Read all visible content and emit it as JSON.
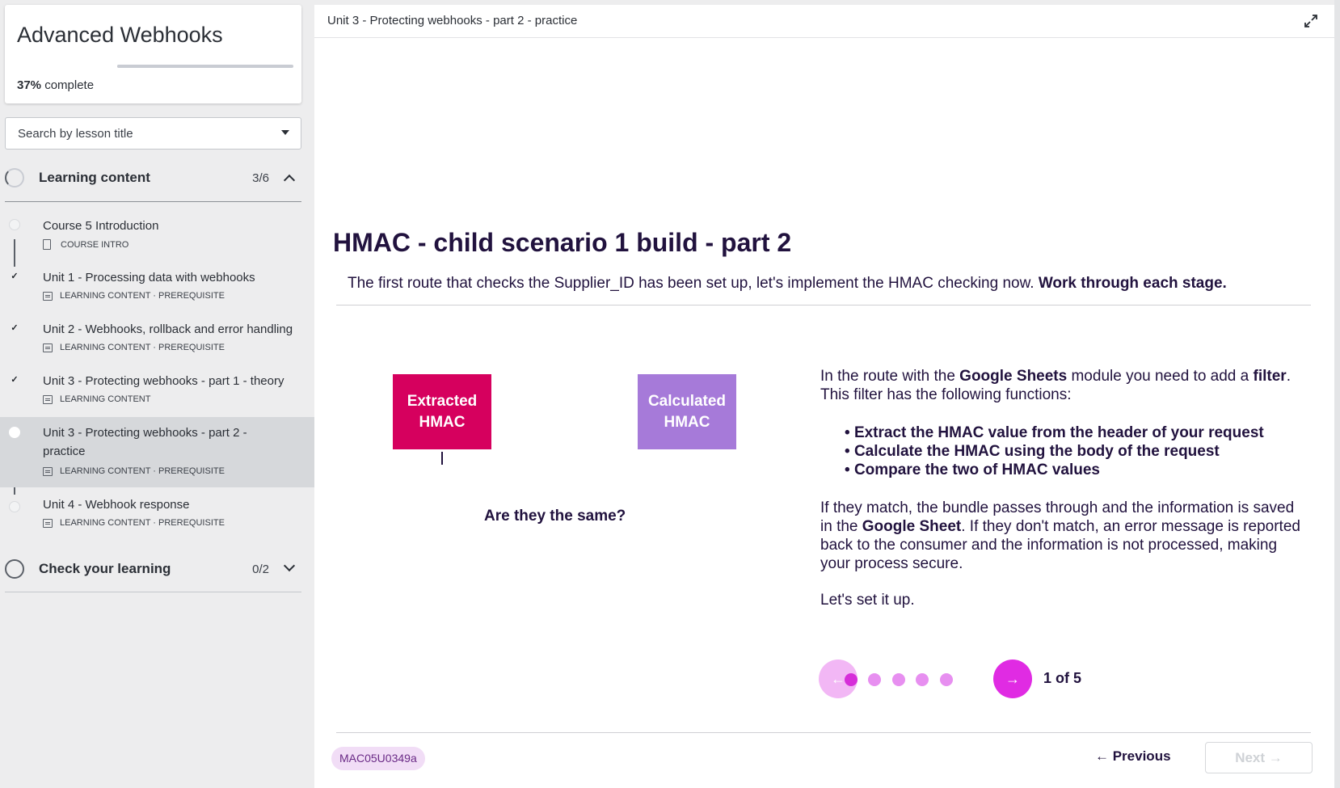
{
  "course": {
    "title": "Advanced Webhooks",
    "progress_percent": 37,
    "progress_value": "37%",
    "progress_suffix": "complete"
  },
  "search": {
    "placeholder": "Search by lesson title"
  },
  "sections": [
    {
      "label": "Learning content",
      "count": "3/6",
      "expanded": true,
      "lessons": [
        {
          "title": "Course 5 Introduction",
          "meta": "COURSE INTRO",
          "done": false,
          "active": false
        },
        {
          "title": "Unit 1 - Processing data with webhooks",
          "meta": "LEARNING CONTENT · PREREQUISITE",
          "done": true,
          "active": false
        },
        {
          "title": "Unit 2 - Webhooks, rollback and error handling",
          "meta": "LEARNING CONTENT · PREREQUISITE",
          "done": true,
          "active": false
        },
        {
          "title": "Unit 3 - Protecting webhooks - part 1 - theory",
          "meta": "LEARNING CONTENT",
          "done": true,
          "active": false
        },
        {
          "title": "Unit 3 - Protecting webhooks - part 2 - practice",
          "meta": "LEARNING CONTENT · PREREQUISITE",
          "done": false,
          "active": true
        },
        {
          "title": "Unit 4 - Webhook response",
          "meta": "LEARNING CONTENT · PREREQUISITE",
          "done": false,
          "active": false
        }
      ]
    },
    {
      "label": "Check your learning",
      "count": "0/2",
      "expanded": false
    }
  ],
  "main": {
    "breadcrumb": "Unit 3 - Protecting webhooks - part 2 - practice",
    "lesson_title": "HMAC - child scenario 1 build - part 2",
    "intro_text": "The first route that checks the Supplier_ID has been set up, let's implement the HMAC checking now.",
    "intro_bold": "Work through each stage.",
    "box_extracted": "Extracted HMAC",
    "box_calculated": "Calculated HMAC",
    "question": "Are they the same?",
    "desc": {
      "p1_a": "In the route with the ",
      "p1_b": "Google Sheets",
      "p1_c": " module you need to add a ",
      "p1_d": "filter",
      "p1_e": ". This filter has the following functions:",
      "bullets": [
        "Extract the HMAC value from the header of your request",
        "Calculate the HMAC using the body of the request",
        "Compare the two of HMAC values"
      ],
      "p2_a": "If they match, the bundle passes through and the information is saved in the ",
      "p2_b": "Google Sheet",
      "p2_c": ". If they don't match, an error message is reported back to the consumer and the information is not processed, making your process secure.",
      "p3": "Let's set it up."
    },
    "carousel": {
      "count_text": "1 of 5",
      "current": 1,
      "total": 5
    },
    "lesson_code": "MAC05U0349a",
    "prev_label": "← Previous",
    "next_label": "Next →"
  },
  "colors": {
    "title": "#21123e",
    "extracted": "#d6005e",
    "calculated": "#a67ad9",
    "carousel_accent": "#e02be3"
  }
}
